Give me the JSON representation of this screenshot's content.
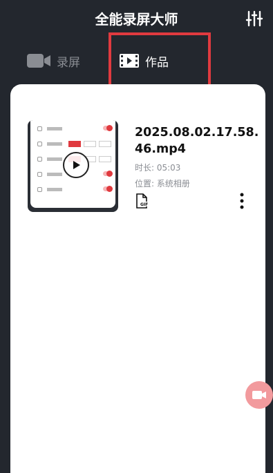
{
  "header": {
    "title": "全能录屏大师"
  },
  "tabs": [
    {
      "label": "录屏"
    },
    {
      "label": "作品"
    }
  ],
  "video": {
    "file_name": "2025.08.02.17.58.46.mp4",
    "duration": "时长: 05:03",
    "location": "位置: 系统相册"
  },
  "colors": {
    "background": "#23272e",
    "accent": "#e03a3f",
    "card": "#ffffff"
  }
}
